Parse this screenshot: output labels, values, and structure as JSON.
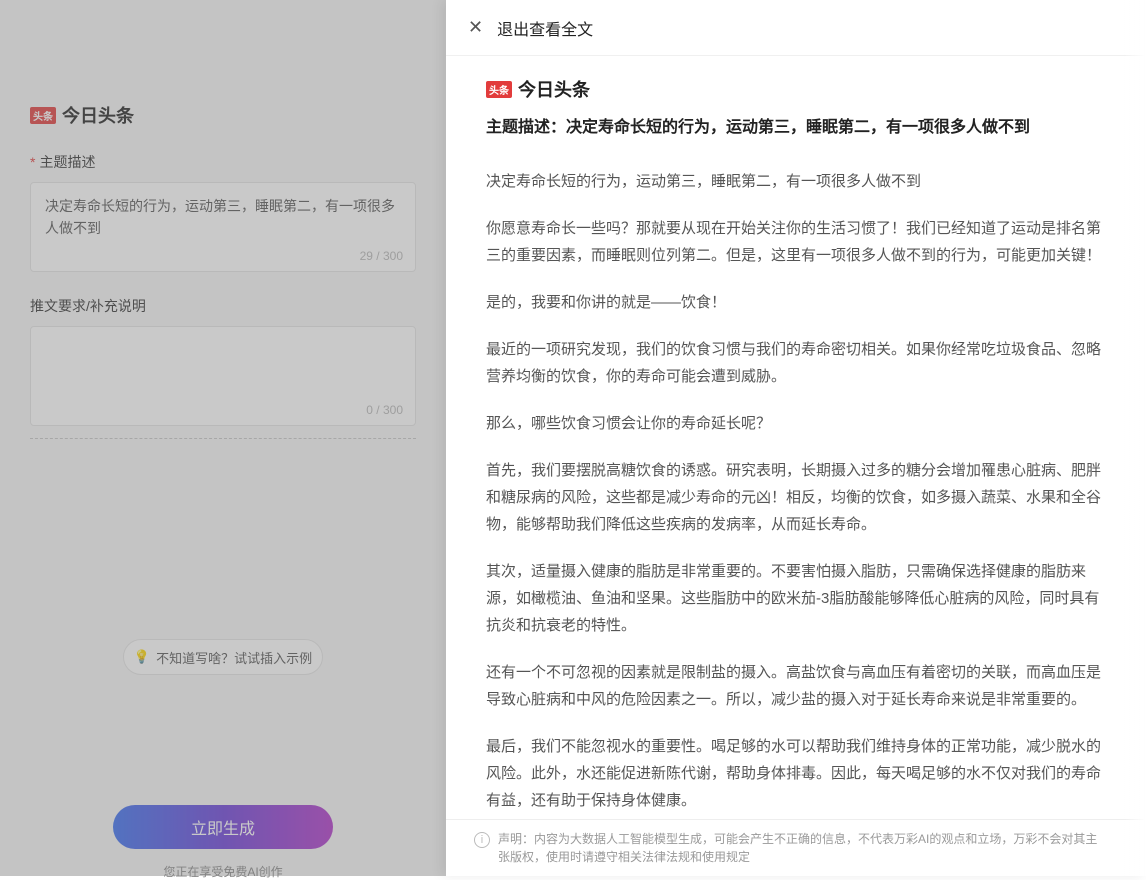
{
  "brand": {
    "badge": "头条",
    "name": "今日头条"
  },
  "left": {
    "topic_label": "主题描述",
    "topic_value": "决定寿命长短的行为，运动第三，睡眠第二，有一项很多人做不到",
    "topic_counter": "29 / 300",
    "req_label": "推文要求/补充说明",
    "req_value": "",
    "req_counter": "0 / 300",
    "example_btn": "不知道写啥？试试插入示例",
    "generate_btn": "立即生成",
    "note": "您正在享受免费AI创作"
  },
  "right": {
    "exit_label": "退出查看全文",
    "title_prefix": "主题描述：",
    "title": "决定寿命长短的行为，运动第三，睡眠第二，有一项很多人做不到",
    "paragraphs": [
      "决定寿命长短的行为，运动第三，睡眠第二，有一项很多人做不到",
      "你愿意寿命长一些吗？那就要从现在开始关注你的生活习惯了！我们已经知道了运动是排名第三的重要因素，而睡眠则位列第二。但是，这里有一项很多人做不到的行为，可能更加关键！",
      "是的，我要和你讲的就是——饮食！",
      "最近的一项研究发现，我们的饮食习惯与我们的寿命密切相关。如果你经常吃垃圾食品、忽略营养均衡的饮食，你的寿命可能会遭到威胁。",
      "那么，哪些饮食习惯会让你的寿命延长呢？",
      "首先，我们要摆脱高糖饮食的诱惑。研究表明，长期摄入过多的糖分会增加罹患心脏病、肥胖和糖尿病的风险，这些都是减少寿命的元凶！相反，均衡的饮食，如多摄入蔬菜、水果和全谷物，能够帮助我们降低这些疾病的发病率，从而延长寿命。",
      "其次，适量摄入健康的脂肪是非常重要的。不要害怕摄入脂肪，只需确保选择健康的脂肪来源，如橄榄油、鱼油和坚果。这些脂肪中的欧米茄-3脂肪酸能够降低心脏病的风险，同时具有抗炎和抗衰老的特性。",
      "还有一个不可忽视的因素就是限制盐的摄入。高盐饮食与高血压有着密切的关联，而高血压是导致心脏病和中风的危险因素之一。所以，减少盐的摄入对于延长寿命来说是非常重要的。",
      "最后，我们不能忽视水的重要性。喝足够的水可以帮助我们维持身体的正常功能，减少脱水的风险。此外，水还能促进新陈代谢，帮助身体排毒。因此，每天喝足够的水不仅对我们的寿命有益，还有助于保持身体健康。"
    ],
    "disclaimer": "声明：内容为大数据人工智能模型生成，可能会产生不正确的信息，不代表万彩AI的观点和立场，万彩不会对其主张版权，使用时请遵守相关法律法规和使用规定"
  }
}
